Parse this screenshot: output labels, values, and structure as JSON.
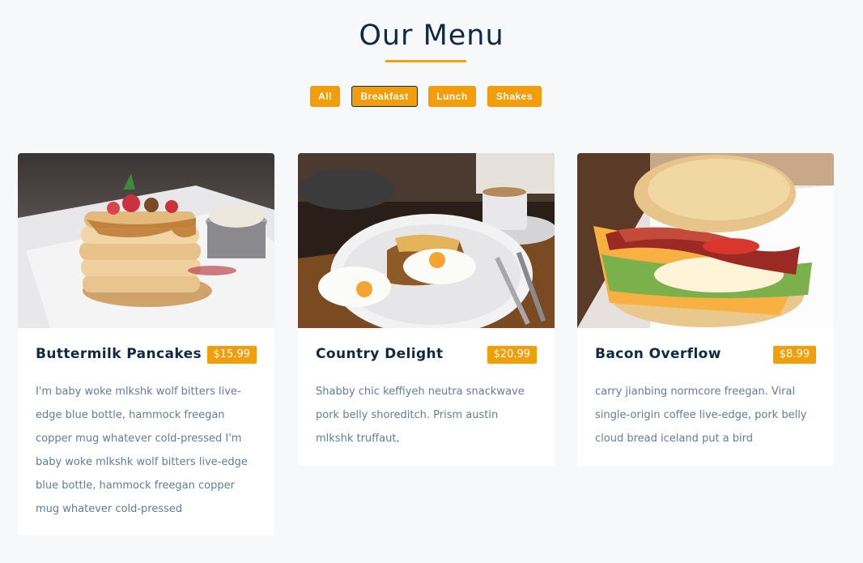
{
  "section": {
    "title": "Our Menu"
  },
  "filters": [
    {
      "label": "All",
      "active": false
    },
    {
      "label": "Breakfast",
      "active": true
    },
    {
      "label": "Lunch",
      "active": false
    },
    {
      "label": "Shakes",
      "active": false
    }
  ],
  "colors": {
    "accent": "#f29d0a",
    "heading": "#102a43",
    "body_text": "#627d98",
    "page_bg": "#f7f8fa"
  },
  "items": [
    {
      "title": "Buttermilk Pancakes",
      "price": "$15.99",
      "description": "I'm baby woke mlkshk wolf bitters live-edge blue bottle, hammock freegan copper mug whatever cold-pressed I'm baby woke mlkshk wolf bitters live-edge blue bottle, hammock freegan copper mug whatever cold-pressed",
      "image_icon": "pancakes-photo"
    },
    {
      "title": "Country Delight",
      "price": "$20.99",
      "description": "Shabby chic keffiyeh neutra snackwave pork belly shoreditch. Prism austin mlkshk truffaut,",
      "image_icon": "eggs-toast-photo"
    },
    {
      "title": "Bacon Overflow",
      "price": "$8.99",
      "description": "carry jianbing normcore freegan. Viral single-origin coffee live-edge, pork belly cloud bread iceland put a bird",
      "image_icon": "bacon-biscuit-photo"
    }
  ]
}
